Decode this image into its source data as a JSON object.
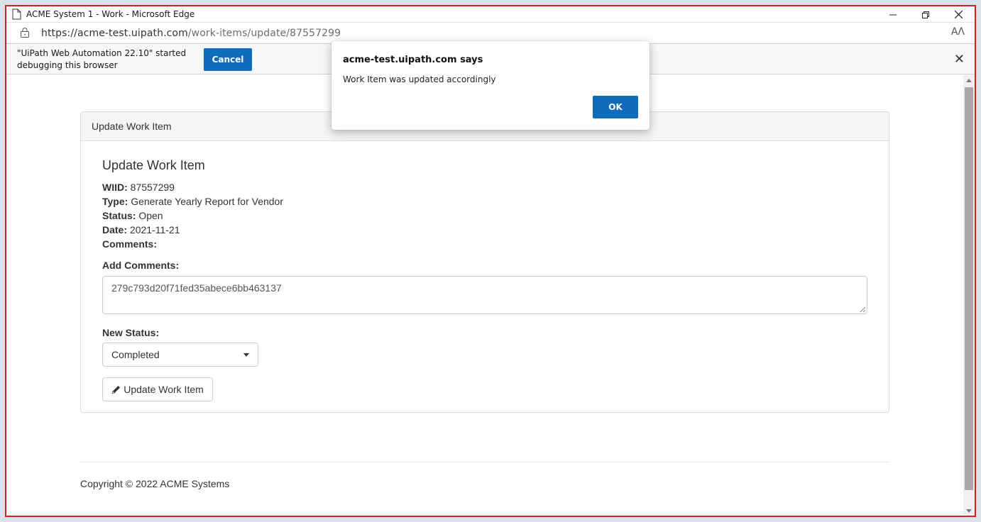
{
  "window": {
    "title": "ACME System 1 - Work - Microsoft Edge",
    "minimize_icon": "minimize-icon",
    "restore_icon": "restore-icon",
    "close_icon": "close-icon"
  },
  "address": {
    "url_host": "https://acme-test.uipath.com",
    "url_path": "/work-items/update/87557299",
    "read_aloud_label": "AɅ"
  },
  "infobar": {
    "message": "\"UiPath Web Automation 22.10\" started debugging this browser",
    "cancel_label": "Cancel",
    "close_label": "✕"
  },
  "panel": {
    "heading": "Update Work Item",
    "form_title": "Update Work Item",
    "fields": [
      {
        "label": "WIID:",
        "value": "87557299"
      },
      {
        "label": "Type:",
        "value": "Generate Yearly Report for Vendor"
      },
      {
        "label": "Status:",
        "value": "Open"
      },
      {
        "label": "Date:",
        "value": "2021-11-21"
      },
      {
        "label": "Comments:",
        "value": ""
      }
    ],
    "add_comments_label": "Add Comments:",
    "comments_value": "279c793d20f71fed35abece6bb463137",
    "new_status_label": "New Status:",
    "status_selected": "Completed",
    "update_button_label": "Update Work Item"
  },
  "footer": {
    "copyright": "Copyright © 2022 ACME Systems"
  },
  "dialog": {
    "title": "acme-test.uipath.com says",
    "message": "Work Item was updated accordingly",
    "ok_label": "OK"
  },
  "colors": {
    "accent": "#0f6cbd",
    "window_border": "#d21f1f"
  }
}
